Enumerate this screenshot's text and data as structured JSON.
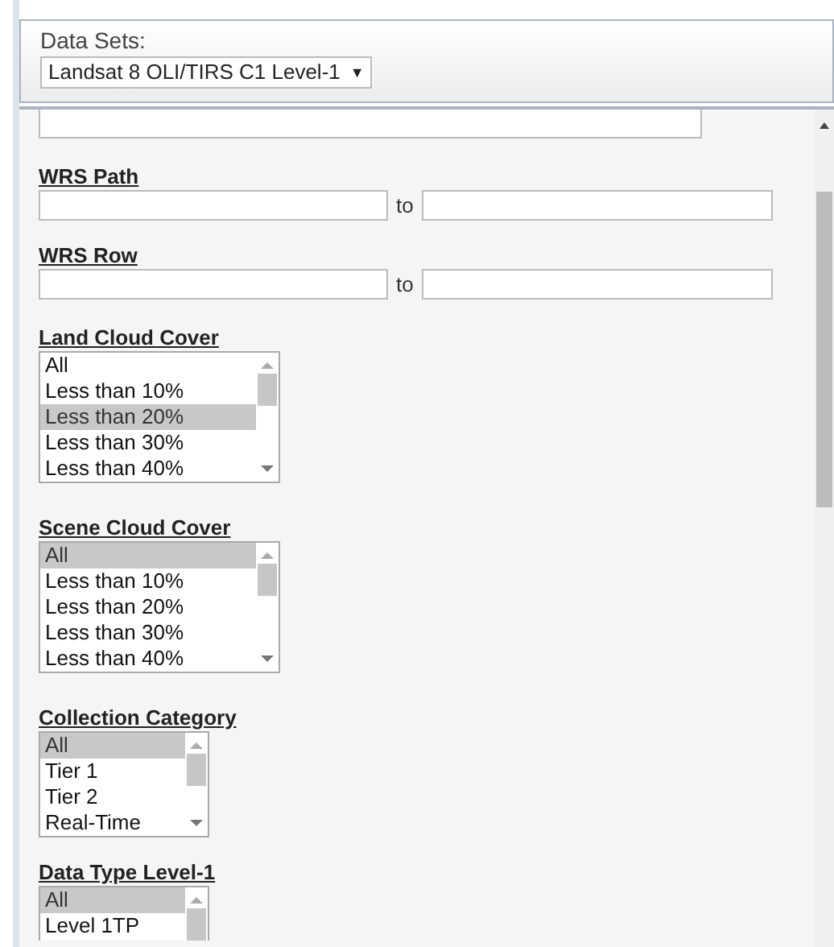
{
  "data_sets": {
    "label": "Data Sets:",
    "value": "Landsat 8 OLI/TIRS C1 Level-1",
    "arrow": "▼"
  },
  "ranges": [
    {
      "label": "WRS Path",
      "separator": "to"
    },
    {
      "label": "WRS Row",
      "separator": "to"
    }
  ],
  "lists": [
    {
      "label": "Land Cloud Cover",
      "options": [
        {
          "text": "All",
          "selected": false
        },
        {
          "text": "Less than 10%",
          "selected": false
        },
        {
          "text": "Less than 20%",
          "selected": true
        },
        {
          "text": "Less than 30%",
          "selected": false
        },
        {
          "text": "Less than 40%",
          "selected": false
        }
      ]
    },
    {
      "label": "Scene Cloud Cover",
      "options": [
        {
          "text": "All",
          "selected": true
        },
        {
          "text": "Less than 10%",
          "selected": false
        },
        {
          "text": "Less than 20%",
          "selected": false
        },
        {
          "text": "Less than 30%",
          "selected": false
        },
        {
          "text": "Less than 40%",
          "selected": false
        }
      ]
    },
    {
      "label": "Collection Category",
      "options": [
        {
          "text": "All",
          "selected": true
        },
        {
          "text": "Tier 1",
          "selected": false
        },
        {
          "text": "Tier 2",
          "selected": false
        },
        {
          "text": "Real-Time",
          "selected": false
        }
      ]
    },
    {
      "label": "Data Type Level-1",
      "options": [
        {
          "text": "All",
          "selected": true
        },
        {
          "text": "Level 1TP",
          "selected": false
        }
      ]
    }
  ]
}
